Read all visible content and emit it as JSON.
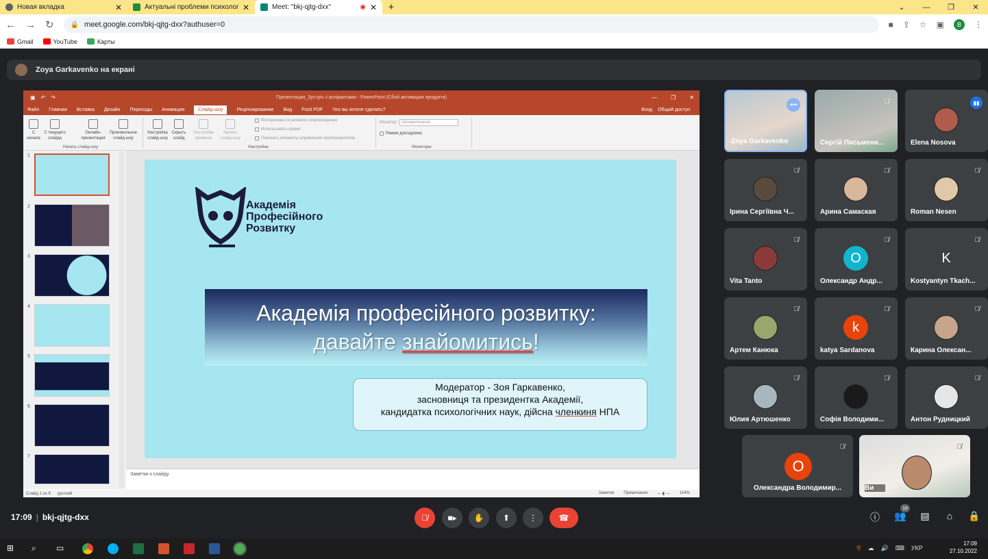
{
  "browser": {
    "tabs": [
      {
        "title": "Новая вкладка",
        "color": "#5f6368"
      },
      {
        "title": "Актуальні проблеми психології",
        "color": "#1e8e3e"
      },
      {
        "title": "Meet: \"bkj-qjtg-dxx\"",
        "color": "#00897b"
      }
    ],
    "url": "meet.google.com/bkj-qjtg-dxx?authuser=0",
    "profile_letter": "B",
    "bookmarks": [
      "Gmail",
      "YouTube",
      "Карты"
    ]
  },
  "meet": {
    "presenter_label": "Zoya Garkavenko на екрані",
    "time": "17:09",
    "code": "bkj-qjtg-dxx",
    "participants_count": "18"
  },
  "powerpoint": {
    "window_title": "Презентация_Зустріч з аспірантами - PowerPoint (Сбой активации продукта)",
    "menu": [
      "Файл",
      "Главная",
      "Вставка",
      "Дизайн",
      "Переходы",
      "Анимация",
      "Слайд-шоу",
      "Рецензирование",
      "Вид",
      "Foxit PDF",
      "Что вы хотите сделать?"
    ],
    "menu_right": [
      "Вход",
      "Общий доступ"
    ],
    "ribbon": {
      "from_start": "С начала",
      "from_current": "С текущего слайда",
      "online": "Онлайн-презентация",
      "custom": "Произвольное слайд-шоу",
      "setup": "Настройка слайд-шоу",
      "hide": "Скрыть слайд",
      "rehearse": "Настройка времени",
      "record": "Запись слайд-шоу",
      "group_start": "Начать слайд-шоу",
      "group_setup": "Настройка",
      "group_monitors": "Мониторы",
      "opt1": "Воспроизвести речевое сопровождение",
      "opt2": "Использовать время",
      "opt3": "Показать элементы управления проигрывателем",
      "monitor_label": "Монитор:",
      "monitor_value": "Автоматически",
      "presenter_view": "Режим докладчика"
    },
    "thumb_numbers": [
      "1",
      "2",
      "3",
      "4",
      "5",
      "6",
      "7"
    ],
    "slide": {
      "logo_line1": "Академія",
      "logo_line2": "Професійного",
      "logo_line3": "Розвитку",
      "title_line1": "Академія професійного розвитку:",
      "title_line2a": "давайте ",
      "title_line2b": "знайомитись",
      "title_line2c": "!",
      "mod_line1": "Модератор - Зоя Гаркавенко,",
      "mod_line2": "засновниця та президентка Академії,",
      "mod_line3a": "кандидатка психологічних наук, дійсна ",
      "mod_line3b": "членкиня",
      "mod_line3c": " НПА"
    },
    "notes_placeholder": "Заметки к слайду",
    "status_slide": "Слайд 1 из 9",
    "status_lang": "русский",
    "status_notes": "Заметки",
    "status_comments": "Примечания",
    "zoom": "104%"
  },
  "participants": [
    {
      "name": "Zoya Garkavenko",
      "type": "photo"
    },
    {
      "name": "Сергій Письменн...",
      "type": "photo"
    },
    {
      "name": "Elena Nosova",
      "type": "face"
    },
    {
      "name": "Ірина Сергіївна Ч...",
      "type": "face"
    },
    {
      "name": "Арина Самаская",
      "type": "face"
    },
    {
      "name": "Roman Nesen",
      "type": "face"
    },
    {
      "name": "Vita Tanto",
      "type": "face"
    },
    {
      "name": "Олександр Андр...",
      "type": "letter",
      "letter": "О",
      "color": "#12b5cb"
    },
    {
      "name": "Kostyantyn Tkach...",
      "type": "letter",
      "letter": "K",
      "color": "#3c4043"
    },
    {
      "name": "Артем Канюка",
      "type": "face"
    },
    {
      "name": "katya Sardanova",
      "type": "letter",
      "letter": "k",
      "color": "#e8430a"
    },
    {
      "name": "Карина Олексан...",
      "type": "face"
    },
    {
      "name": "Юлия Артюшенко",
      "type": "face"
    },
    {
      "name": "Софія Володими...",
      "type": "face"
    },
    {
      "name": "Антон Рудницкий",
      "type": "face"
    },
    {
      "name": "Олександра Володимир...",
      "type": "letter",
      "letter": "О",
      "color": "#e8430a"
    },
    {
      "name": "Ви",
      "type": "photo"
    }
  ],
  "taskbar": {
    "lang": "УКР",
    "time": "17:09",
    "date": "27.10.2022"
  },
  "colors": {
    "meet_bg": "#202124",
    "ppt_accent": "#b7472a",
    "slide_bg": "#a6e6f1",
    "hangup": "#ea4335"
  }
}
